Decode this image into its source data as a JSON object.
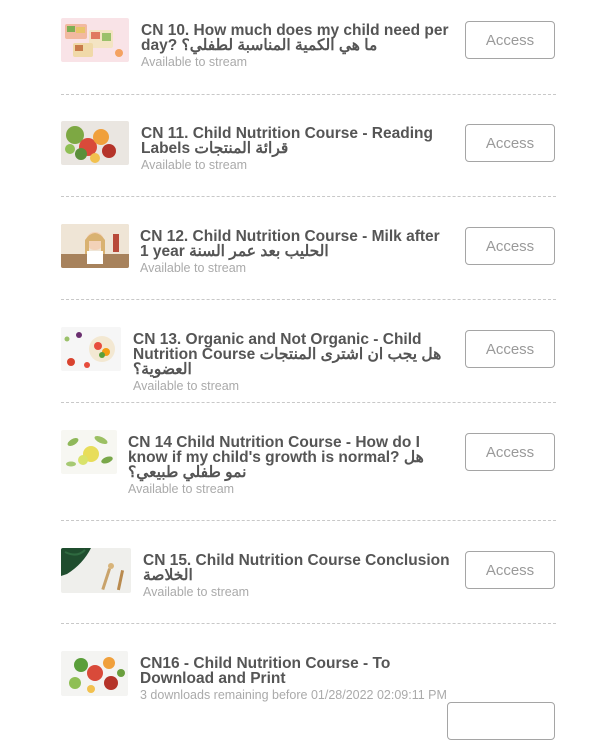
{
  "lessons": [
    {
      "title": "CN 10. How much does my child need per day? ما هي الكمية المناسبة لطفلي؟",
      "status": "Available to stream",
      "button": "Access",
      "thumb_icon": "food-bowls-thumbnail"
    },
    {
      "title": "CN 11. Child Nutrition Course - Reading Labels قرائة المنتجات",
      "status": "Available to stream",
      "button": "Access",
      "thumb_icon": "vegetables-thumbnail"
    },
    {
      "title": "CN 12. Child Nutrition Course - Milk after 1 year الحليب بعد عمر السنة",
      "status": "Available to stream",
      "button": "Access",
      "thumb_icon": "girl-kitchen-thumbnail"
    },
    {
      "title": "CN 13. Organic and Not Organic - Child Nutrition Course هل يجب ان اشترى المنتجات العضوية؟",
      "status": "Available to stream",
      "button": "Access",
      "thumb_icon": "fruit-bowl-thumbnail"
    },
    {
      "title": "CN 14 Child Nutrition Course - How do I know if my child's growth is normal? هل نمو طفلي طبيعي؟",
      "status": "Available to stream",
      "button": "Access",
      "thumb_icon": "lemons-thumbnail"
    },
    {
      "title": "CN 15. Child Nutrition Course Conclusion الخلاصة",
      "status": "Available to stream",
      "button": "Access",
      "thumb_icon": "leaf-thumbnail"
    },
    {
      "title": "CN16 - Child Nutrition Course - To Download and Print",
      "status": "3 downloads remaining before 01/28/2022 02:09:11 PM",
      "button": "",
      "thumb_icon": "salad-thumbnail"
    }
  ]
}
